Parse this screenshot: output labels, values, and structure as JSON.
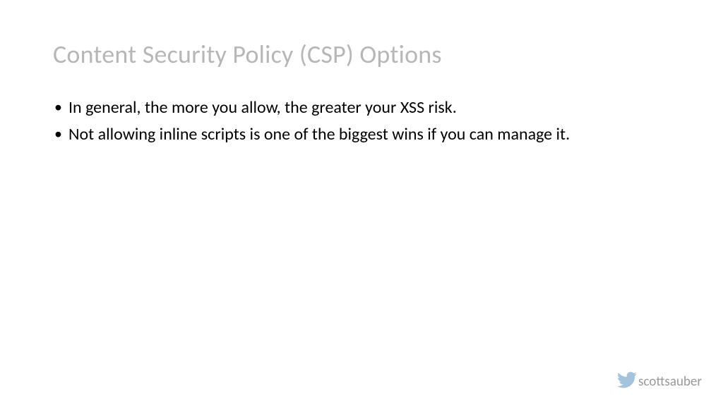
{
  "title": "Content Security Policy (CSP) Options",
  "bullets": [
    "In general, the more you allow, the greater your XSS risk.",
    "Not allowing inline scripts is one of the biggest wins if you can manage it."
  ],
  "footer": {
    "handle": "scottsauber"
  }
}
